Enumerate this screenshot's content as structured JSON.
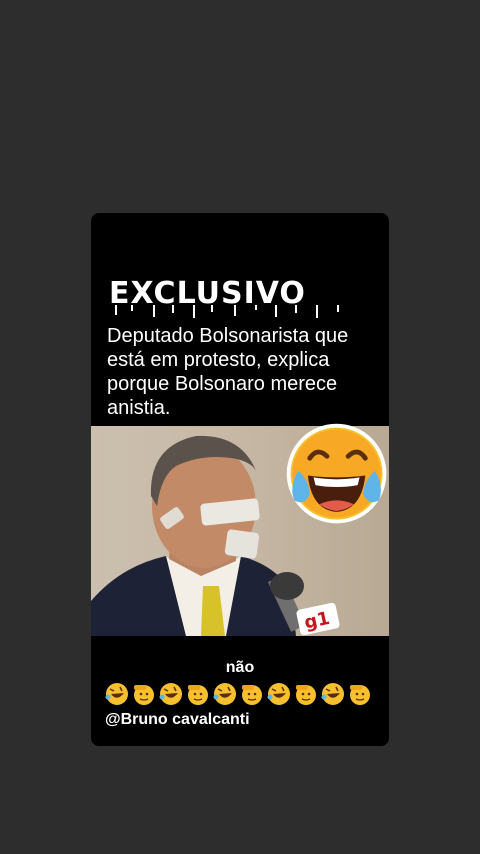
{
  "story": {
    "headline": "EXCLUSIVO",
    "description": "Deputado Bolsonarista que está em protesto, explica porque Bolsonaro merece anistia.",
    "photo_alt": "Deputado com fita adesiva no rosto",
    "mic_logo": "g1",
    "sticker_icon": "face-with-tears-of-joy-icon",
    "caption": "não",
    "emoji_row": [
      "rolling-on-floor-laughing-icon",
      "saluting-face-icon",
      "rolling-on-floor-laughing-icon",
      "saluting-face-icon",
      "rolling-on-floor-laughing-icon",
      "saluting-face-icon",
      "rolling-on-floor-laughing-icon",
      "saluting-face-icon",
      "rolling-on-floor-laughing-icon",
      "saluting-face-icon"
    ],
    "handle": "@Bruno cavalcanti"
  },
  "colors": {
    "background": "#2e2d2d",
    "card": "#000000",
    "emoji_yellow": "#f7c02e"
  }
}
